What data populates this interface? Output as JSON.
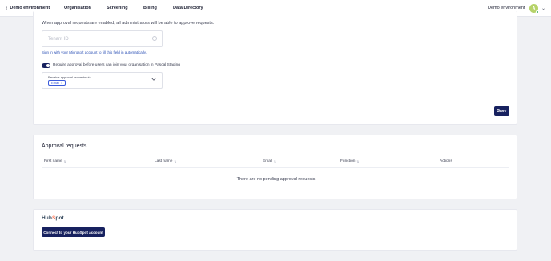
{
  "nav": {
    "back_label": "Demo environment",
    "tabs": [
      {
        "label": "Organisation",
        "active": true
      },
      {
        "label": "Screening",
        "active": false
      },
      {
        "label": "Billing",
        "active": false
      },
      {
        "label": "Data Directory",
        "active": false
      }
    ],
    "environment": "Demo environment",
    "avatar_initial": "A"
  },
  "approval_settings": {
    "description": "When approval requests are enabled, all administrators will be able to approve requests.",
    "tenant_placeholder": "Tenant ID",
    "signin_link": "Sign in with your Microsoft account to fill this field in automatically.",
    "toggle_on": true,
    "toggle_label": "Require approval before users can join your organisation in Pascal Staging",
    "receive_label": "Receive approval requests via",
    "receive_chip": "Email",
    "save_label": "Save"
  },
  "approval_requests": {
    "title": "Approval requests",
    "columns": [
      "First name",
      "Last name",
      "Email",
      "Function"
    ],
    "actions_label": "Actions",
    "empty_text": "There are no pending approval requests"
  },
  "hubspot": {
    "brand": "HubSpot",
    "connect_label": "Connect to your HubSpot account"
  },
  "colors": {
    "primary": "#17215f",
    "link": "#2a4fb5",
    "background": "#f0f1f4",
    "hubspot_accent": "#ff7a59"
  }
}
